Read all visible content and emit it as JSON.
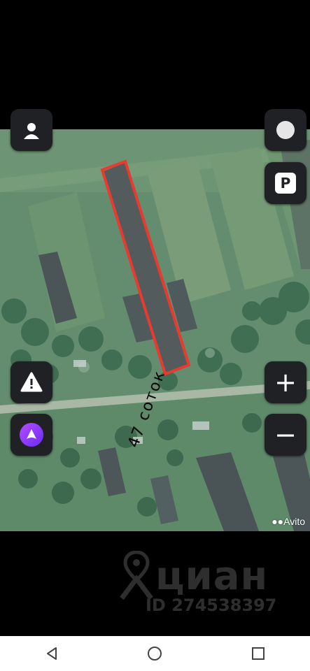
{
  "map": {
    "plot_label": "47 соток",
    "avito_watermark": "Avito",
    "parking_label": "P",
    "zoom_in_label": "+",
    "zoom_out_label": "−",
    "highlight_color": "#e83a2e"
  },
  "watermark": {
    "brand": "циан",
    "id_text": "ID 274538397"
  },
  "icons": {
    "top_left": "person-icon",
    "top_right": "circle-icon",
    "warning": "warning-icon",
    "alice": "alice-icon",
    "back": "back-triangle-icon",
    "home": "home-circle-icon",
    "recents": "recents-square-icon"
  }
}
